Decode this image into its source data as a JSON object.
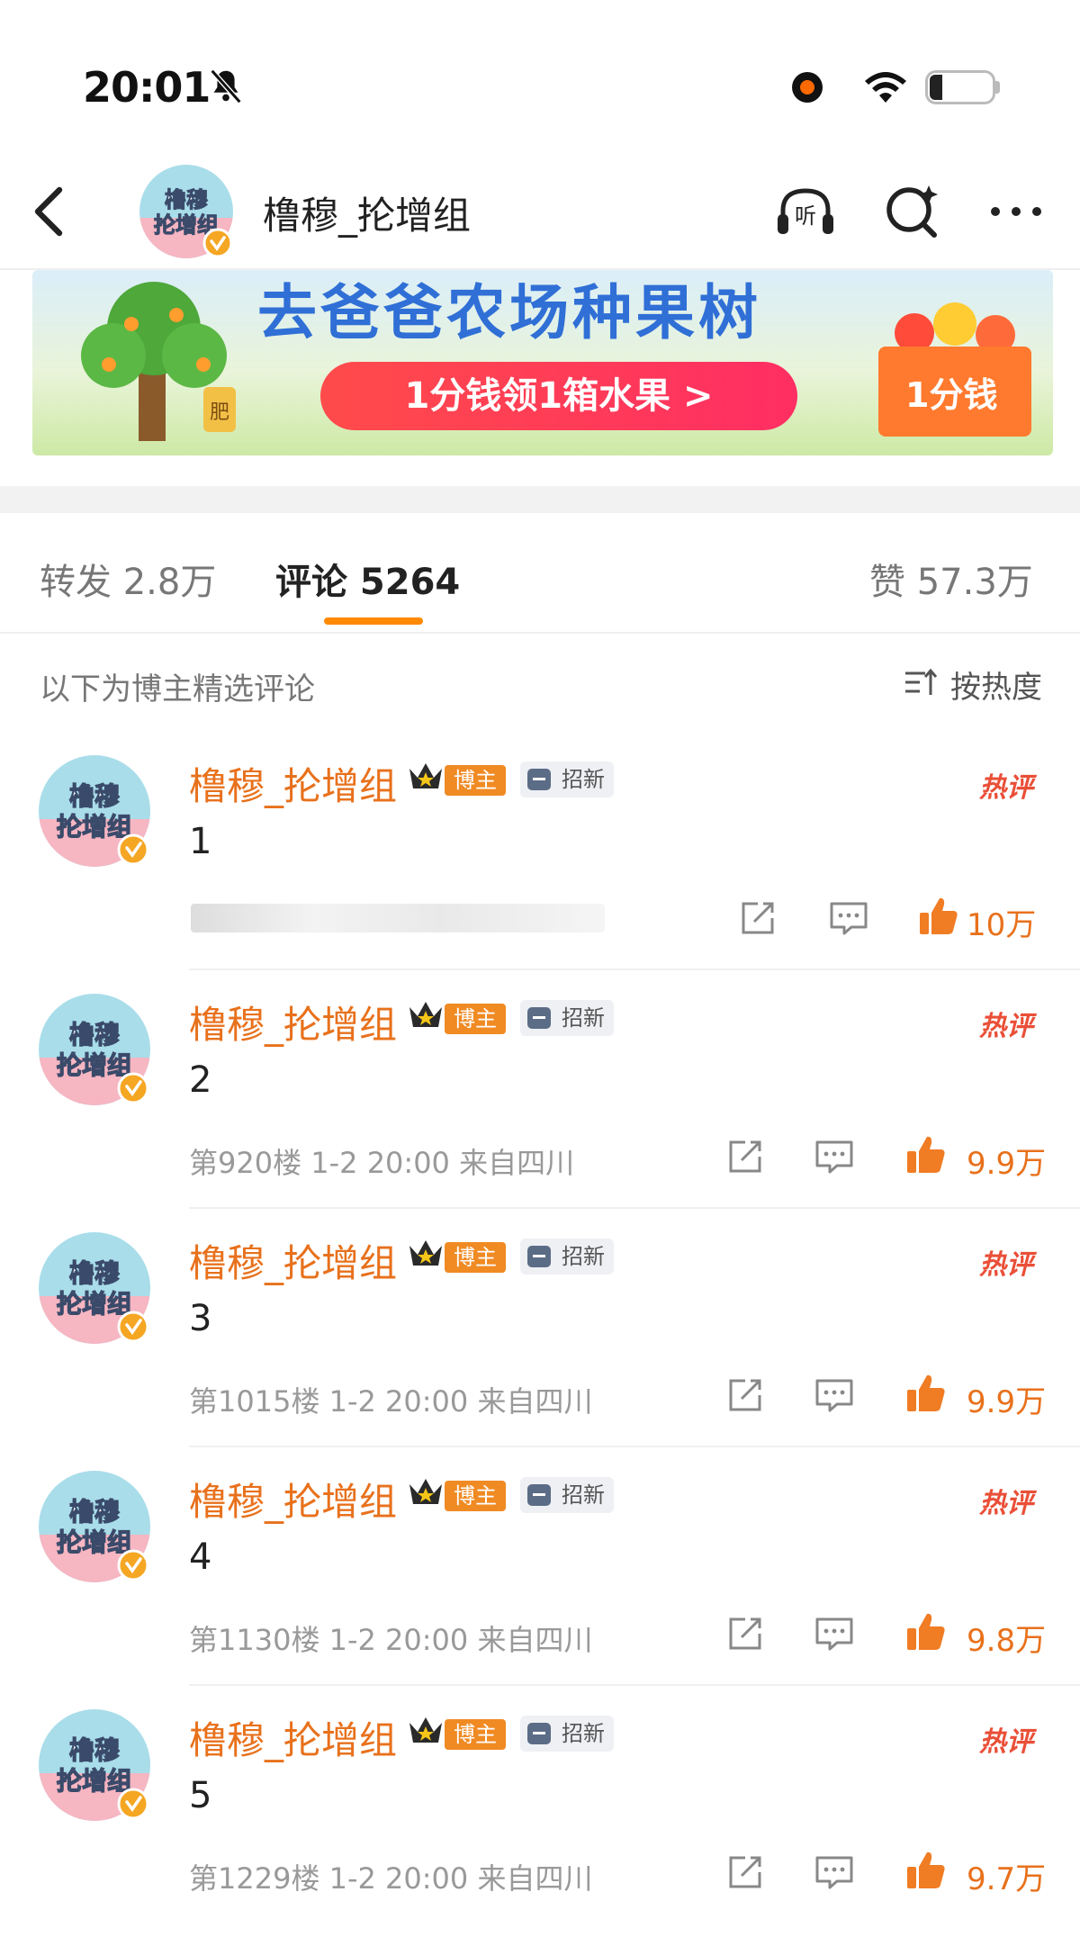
{
  "status_bar": {
    "time": "20:01",
    "battery": "23"
  },
  "header": {
    "account_name": "橹穆_抡增组"
  },
  "banner": {
    "title": "去爸爸农场种果树",
    "cta": "1分钱领1箱水果 >",
    "box_label": "1分钱",
    "fertilizer_label": "肥"
  },
  "tabs": {
    "repost": "转发 2.8万",
    "comments": "评论 5264",
    "likes": "赞 57.3万"
  },
  "list": {
    "selected_label": "以下为博主精选评论",
    "sort_label": "按热度"
  },
  "comments": [
    {
      "name": "橹穆_抡增组",
      "badge_author": "博主",
      "badge_tag": "招新",
      "hot": "热评",
      "text": "1",
      "meta": "",
      "likes": "10万"
    },
    {
      "name": "橹穆_抡增组",
      "badge_author": "博主",
      "badge_tag": "招新",
      "hot": "热评",
      "text": "2",
      "meta": "第920楼 1-2 20:00 来自四川",
      "likes": "9.9万"
    },
    {
      "name": "橹穆_抡增组",
      "badge_author": "博主",
      "badge_tag": "招新",
      "hot": "热评",
      "text": "3",
      "meta": "第1015楼 1-2 20:00 来自四川",
      "likes": "9.9万"
    },
    {
      "name": "橹穆_抡增组",
      "badge_author": "博主",
      "badge_tag": "招新",
      "hot": "热评",
      "text": "4",
      "meta": "第1130楼 1-2 20:00 来自四川",
      "likes": "9.8万"
    },
    {
      "name": "橹穆_抡增组",
      "badge_author": "博主",
      "badge_tag": "招新",
      "hot": "热评",
      "text": "5",
      "meta": "第1229楼 1-2 20:00 来自四川",
      "likes": "9.7万"
    }
  ],
  "colors": {
    "accent": "#e8711c",
    "hot": "#ea4f38",
    "tab_underline": "#ff8a00",
    "verified": "#f5a623"
  }
}
